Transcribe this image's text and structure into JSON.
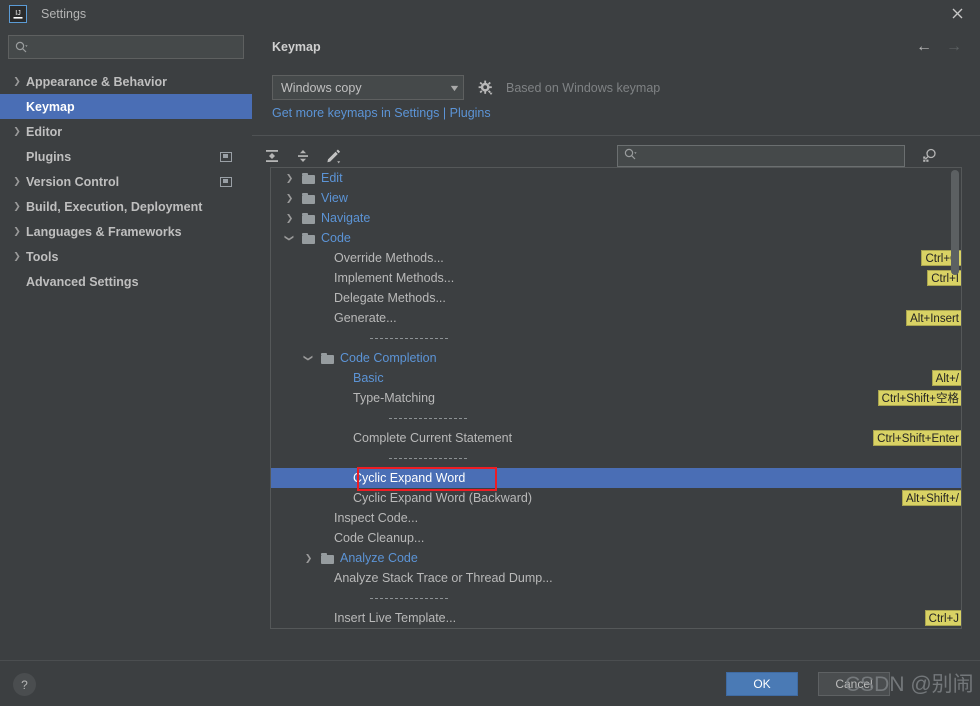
{
  "window": {
    "title": "Settings",
    "logo_icon": "intellij-idea-logo",
    "close_icon": "close-icon"
  },
  "sidebar": {
    "search": {
      "placeholder": "",
      "value": "",
      "icon": "search-icon"
    },
    "items": [
      {
        "label": "Appearance & Behavior",
        "expandable": true,
        "selected": false,
        "trailing_icon": ""
      },
      {
        "label": "Keymap",
        "expandable": false,
        "selected": true,
        "trailing_icon": ""
      },
      {
        "label": "Editor",
        "expandable": true,
        "selected": false,
        "trailing_icon": ""
      },
      {
        "label": "Plugins",
        "expandable": false,
        "selected": false,
        "trailing_icon": "window-icon"
      },
      {
        "label": "Version Control",
        "expandable": true,
        "selected": false,
        "trailing_icon": "window-icon"
      },
      {
        "label": "Build, Execution, Deployment",
        "expandable": true,
        "selected": false,
        "trailing_icon": ""
      },
      {
        "label": "Languages & Frameworks",
        "expandable": true,
        "selected": false,
        "trailing_icon": ""
      },
      {
        "label": "Tools",
        "expandable": true,
        "selected": false,
        "trailing_icon": ""
      },
      {
        "label": "Advanced Settings",
        "expandable": false,
        "selected": false,
        "trailing_icon": ""
      }
    ]
  },
  "panel": {
    "title": "Keymap",
    "nav_back_icon": "arrow-left-icon",
    "nav_forward_icon": "arrow-right-icon",
    "keymap_select": {
      "value": "Windows copy",
      "caret_icon": "chevron-down-icon"
    },
    "gear_icon": "gear-icon",
    "based_on": "Based on Windows keymap",
    "more_keymaps_link": "Get more keymaps in Settings | Plugins",
    "toolbar": {
      "expand_all_icon": "expand-all-icon",
      "collapse_all_icon": "collapse-all-icon",
      "edit_shortcut_icon": "pencil-edit-icon",
      "search_placeholder": "",
      "search_value": "",
      "search_icon": "search-icon",
      "find_by_shortcut_icon": "find-by-shortcut-icon"
    }
  },
  "keymap_tree": [
    {
      "type": "group",
      "indent": 0,
      "label": "Edit",
      "expanded": false,
      "shortcut": ""
    },
    {
      "type": "group",
      "indent": 0,
      "label": "View",
      "expanded": false,
      "shortcut": ""
    },
    {
      "type": "group",
      "indent": 0,
      "label": "Navigate",
      "expanded": false,
      "shortcut": ""
    },
    {
      "type": "group",
      "indent": 0,
      "label": "Code",
      "expanded": true,
      "shortcut": ""
    },
    {
      "type": "action",
      "indent": 1,
      "label": "Override Methods...",
      "shortcut": "Ctrl+O"
    },
    {
      "type": "action",
      "indent": 1,
      "label": "Implement Methods...",
      "shortcut": "Ctrl+I"
    },
    {
      "type": "action",
      "indent": 1,
      "label": "Delegate Methods...",
      "shortcut": ""
    },
    {
      "type": "action",
      "indent": 1,
      "label": "Generate...",
      "shortcut": "Alt+Insert"
    },
    {
      "type": "sep",
      "indent": 1,
      "label": "",
      "shortcut": ""
    },
    {
      "type": "group",
      "indent": 1,
      "label": "Code Completion",
      "expanded": true,
      "shortcut": ""
    },
    {
      "type": "action",
      "indent": 2,
      "label": "Basic",
      "link": true,
      "shortcut": "Alt+/"
    },
    {
      "type": "action",
      "indent": 2,
      "label": "Type-Matching",
      "shortcut": "Ctrl+Shift+空格"
    },
    {
      "type": "sep",
      "indent": 2,
      "label": "",
      "shortcut": ""
    },
    {
      "type": "action",
      "indent": 2,
      "label": "Complete Current Statement",
      "shortcut": "Ctrl+Shift+Enter"
    },
    {
      "type": "sep",
      "indent": 2,
      "label": "",
      "shortcut": ""
    },
    {
      "type": "action",
      "indent": 2,
      "label": "Cyclic Expand Word",
      "selected": true,
      "highlighted": true,
      "shortcut": ""
    },
    {
      "type": "action",
      "indent": 2,
      "label": "Cyclic Expand Word (Backward)",
      "shortcut": "Alt+Shift+/"
    },
    {
      "type": "action",
      "indent": 1,
      "label": "Inspect Code...",
      "shortcut": ""
    },
    {
      "type": "action",
      "indent": 1,
      "label": "Code Cleanup...",
      "shortcut": ""
    },
    {
      "type": "group",
      "indent": 1,
      "label": "Analyze Code",
      "expanded": false,
      "shortcut": ""
    },
    {
      "type": "action",
      "indent": 1,
      "label": "Analyze Stack Trace or Thread Dump...",
      "shortcut": ""
    },
    {
      "type": "sep",
      "indent": 1,
      "label": "",
      "shortcut": ""
    },
    {
      "type": "action",
      "indent": 1,
      "label": "Insert Live Template...",
      "shortcut": "Ctrl+J"
    }
  ],
  "footer": {
    "help_label": "?",
    "ok_label": "OK",
    "cancel_label": "Cancel"
  },
  "watermark": "CSDN @别闹",
  "colors": {
    "selection_blue": "#4a6eb5",
    "link_blue": "#5c94d6",
    "shortcut_badge": "#d9d264",
    "annotation_red": "#ee1d24",
    "window_bg": "#3c3f41"
  }
}
